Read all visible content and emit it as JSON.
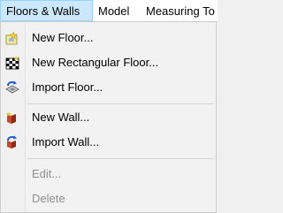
{
  "menubar": {
    "items": [
      {
        "label": "Floors & Walls"
      },
      {
        "label": "Model"
      },
      {
        "label": "Measuring To"
      }
    ]
  },
  "dropdown": {
    "items": [
      {
        "label": "New Floor...",
        "icon": "new-floor-icon",
        "enabled": true
      },
      {
        "label": "New Rectangular Floor...",
        "icon": "new-rectangular-floor-icon",
        "enabled": true
      },
      {
        "label": "Import Floor...",
        "icon": "import-floor-icon",
        "enabled": true
      },
      {
        "label": "New Wall...",
        "icon": "new-wall-icon",
        "enabled": true
      },
      {
        "label": "Import Wall...",
        "icon": "import-wall-icon",
        "enabled": true
      },
      {
        "label": "Edit...",
        "enabled": false
      },
      {
        "label": "Delete",
        "enabled": false
      }
    ]
  },
  "colors": {
    "active_menu_bg": "#cce8ff",
    "active_menu_border": "#99d1ff",
    "disabled_text": "#8f8f8f"
  }
}
